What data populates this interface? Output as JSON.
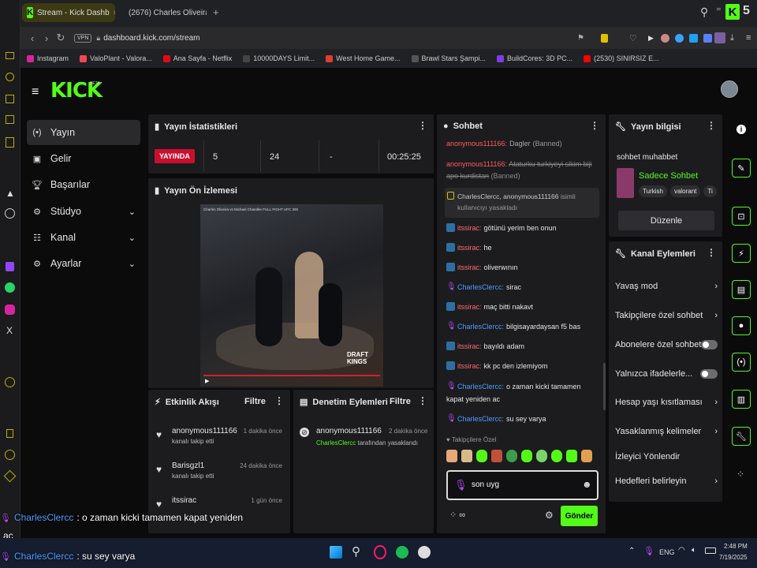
{
  "browser": {
    "tabs": [
      {
        "label": "Stream - Kick Dashb"
      },
      {
        "label": "(2676) Charles Oliveira v"
      }
    ],
    "new_tab": "+",
    "url": "dashboard.kick.com/stream",
    "vpn": "VPN",
    "ext_count": "5",
    "bookmarks": [
      {
        "label": "Instagram",
        "color": "#d6249f"
      },
      {
        "label": "ValoPlant - Valora...",
        "color": "#ff4655"
      },
      {
        "label": "Ana Sayfa - Netflix",
        "color": "#e50914"
      },
      {
        "label": "10000DAYS Limit...",
        "color": "#444444"
      },
      {
        "label": "West Home Game...",
        "color": "#e03c31"
      },
      {
        "label": "Brawl Stars Şampi...",
        "color": "#555555"
      },
      {
        "label": "BuildCores: 3D PC...",
        "color": "#7b3fe4"
      },
      {
        "label": "(2530) SINIRSIZ E...",
        "color": "#ff0000"
      }
    ]
  },
  "header": {
    "logo": "KICK",
    "beta": "BETA"
  },
  "sidebar": {
    "items": [
      {
        "label": "Yayın",
        "icon": "broadcast-icon"
      },
      {
        "label": "Gelir",
        "icon": "income-icon"
      },
      {
        "label": "Başarılar",
        "icon": "trophy-icon"
      },
      {
        "label": "Stüdyo",
        "icon": "studio-icon"
      },
      {
        "label": "Kanal",
        "icon": "channel-icon"
      },
      {
        "label": "Ayarlar",
        "icon": "gear-icon"
      }
    ]
  },
  "stats": {
    "title": "Yayın İstatistikleri",
    "live_badge": "YAYINDA",
    "val1": "5",
    "val2": "24",
    "val3": "-",
    "duration": "00:25:25"
  },
  "preview": {
    "title": "Yayın Ön İzlemesi",
    "video_caption": "Charles Oliveira vs Michael Chandler FULL FIGHT UFC 300",
    "overlay_text": "DRAFT KINGS"
  },
  "activity": {
    "title": "Etkinlik Akışı",
    "filter": "Filtre",
    "rows": [
      {
        "name": "anonymous111166",
        "time": "1 dakika önce",
        "sub": "kanalı takip etti"
      },
      {
        "name": "Barisgzl1",
        "time": "24 dakika önce",
        "sub": "kanalı takip etti"
      },
      {
        "name": "itssirac",
        "time": "1 gün önce",
        "sub": ""
      }
    ]
  },
  "moderation": {
    "title": "Denetim Eylemleri",
    "filter": "Filtre",
    "row": {
      "name": "anonymous111166",
      "time": "2 dakika önce",
      "actor": "CharlesClercc",
      "sub": "tarafından yasaklandı"
    }
  },
  "chat": {
    "title": "Sohbet",
    "banned1_user": "anonymous111166:",
    "banned1_msg": "Dagler",
    "banned1_tag": "(Banned)",
    "banned2_user": "anonymous111166:",
    "banned2_msg": "Ataturku turkiyeyi sikim biji apo kurdistan",
    "banned2_tag": "(Banned)",
    "notice_line1_users": "CharlesClercc, anonymous111166",
    "notice_line1_tail": "isimli",
    "notice_line2": "kullanıcıyı yasakladı",
    "messages": [
      {
        "user": "itssirac:",
        "text": "götünü yerim ben onun",
        "type": "blue"
      },
      {
        "user": "itssirac:",
        "text": "he",
        "type": "blue"
      },
      {
        "user": "itssirac:",
        "text": "oliverwının",
        "type": "blue"
      },
      {
        "user": "CharlesClercc:",
        "text": "sirac",
        "type": "mic"
      },
      {
        "user": "itssirac:",
        "text": "maç bitti nakavt",
        "type": "blue"
      },
      {
        "user": "CharlesClercc:",
        "text": "bilgisayardaysan f5 bas",
        "type": "mic"
      },
      {
        "user": "itssirac:",
        "text": "bayıldı adam",
        "type": "blue"
      },
      {
        "user": "itssirac:",
        "text": "kk pc den izlemiyom",
        "type": "blue"
      },
      {
        "user": "CharlesClercc:",
        "text": "o zaman kicki tamamen",
        "type": "mic"
      },
      {
        "user": "CharlesClercc:",
        "text": "su sey varya",
        "type": "mic"
      }
    ],
    "msg9_cont": "kapat yeniden ac",
    "followers_only": "Takipçilere Özel",
    "input_value": "son uyg",
    "send": "Gönder"
  },
  "info": {
    "title": "Yayın bilgisi",
    "stream_title": "sohbet muhabbet",
    "category": "Sadece Sohbet",
    "tags": [
      "Turkish",
      "valorant",
      "Ti"
    ],
    "edit": "Düzenle"
  },
  "channel_actions": {
    "title": "Kanal Eylemleri",
    "items": [
      {
        "label": "Yavaş mod",
        "control": "chevron"
      },
      {
        "label": "Takipçilere özel sohbet",
        "control": "chevron"
      },
      {
        "label": "Abonelere özel sohbet",
        "control": "toggle"
      },
      {
        "label": "Yalnızca ifadelerle...",
        "control": "toggle"
      },
      {
        "label": "Hesap yaşı kısıtlaması",
        "control": "chevron"
      },
      {
        "label": "Yasaklanmış kelimeler",
        "control": "chevron"
      },
      {
        "label": "İzleyici Yönlendir",
        "control": "none"
      },
      {
        "label": "Hedefleri belirleyin",
        "control": "chevron"
      }
    ]
  },
  "overlay": {
    "line1_user": "CharlesClercc",
    "line1_text": ": o zaman kicki tamamen kapat yeniden",
    "line1_cont": "ac",
    "line2_user": "CharlesClercc",
    "line2_text": ": su sey varya"
  },
  "taskbar": {
    "lang": "ENG",
    "time": "2:48 PM",
    "date": "7/19/2025"
  },
  "colors": {
    "kick_green": "#53fc18",
    "live_red": "#c8102e",
    "panel": "#1c1c1f"
  }
}
